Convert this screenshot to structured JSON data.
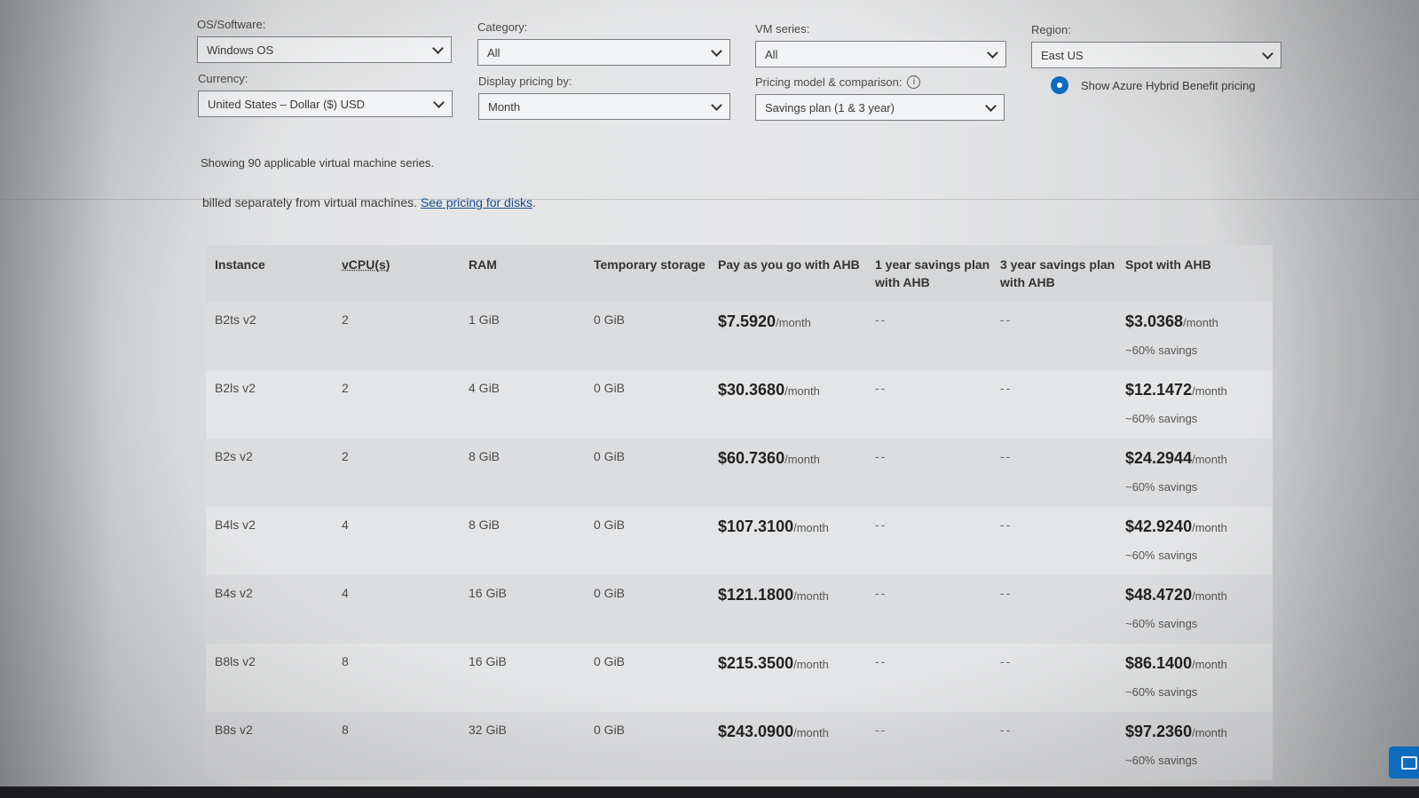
{
  "filters": {
    "os": {
      "label": "OS/Software:",
      "value": "Windows OS"
    },
    "category": {
      "label": "Category:",
      "value": "All"
    },
    "vm_series": {
      "label": "VM series:",
      "value": "All"
    },
    "region": {
      "label": "Region:",
      "value": "East US"
    },
    "currency": {
      "label": "Currency:",
      "value": "United States – Dollar ($) USD"
    },
    "display_pricing": {
      "label": "Display pricing by:",
      "value": "Month"
    },
    "pricing_model": {
      "label": "Pricing model & comparison:",
      "value": "Savings plan (1 & 3 year)",
      "info": "i"
    },
    "ahb_toggle": {
      "label": "Show Azure Hybrid Benefit pricing"
    }
  },
  "showing_text": "Showing 90 applicable virtual machine series.",
  "notice": {
    "text": "billed separately from virtual machines. ",
    "link": "See pricing for disks",
    "end": "."
  },
  "table": {
    "headers": [
      "Instance",
      "vCPU(s)",
      "RAM",
      "Temporary storage",
      "Pay as you go with AHB",
      "1 year savings plan with AHB",
      "3 year savings plan with AHB",
      "Spot with AHB"
    ],
    "per_month": "/month",
    "rows": [
      {
        "instance": "B2ts v2",
        "vcpu": "2",
        "ram": "1 GiB",
        "temp": "0 GiB",
        "payg": "$7.5920",
        "y1": "--",
        "y3": "--",
        "spot": "$3.0368",
        "savings": "~60% savings"
      },
      {
        "instance": "B2ls v2",
        "vcpu": "2",
        "ram": "4 GiB",
        "temp": "0 GiB",
        "payg": "$30.3680",
        "y1": "--",
        "y3": "--",
        "spot": "$12.1472",
        "savings": "~60% savings"
      },
      {
        "instance": "B2s v2",
        "vcpu": "2",
        "ram": "8 GiB",
        "temp": "0 GiB",
        "payg": "$60.7360",
        "y1": "--",
        "y3": "--",
        "spot": "$24.2944",
        "savings": "~60% savings"
      },
      {
        "instance": "B4ls v2",
        "vcpu": "4",
        "ram": "8 GiB",
        "temp": "0 GiB",
        "payg": "$107.3100",
        "y1": "--",
        "y3": "--",
        "spot": "$42.9240",
        "savings": "~60% savings"
      },
      {
        "instance": "B4s v2",
        "vcpu": "4",
        "ram": "16 GiB",
        "temp": "0 GiB",
        "payg": "$121.1800",
        "y1": "--",
        "y3": "--",
        "spot": "$48.4720",
        "savings": "~60% savings"
      },
      {
        "instance": "B8ls v2",
        "vcpu": "8",
        "ram": "16 GiB",
        "temp": "0 GiB",
        "payg": "$215.3500",
        "y1": "--",
        "y3": "--",
        "spot": "$86.1400",
        "savings": "~60% savings"
      },
      {
        "instance": "B8s v2",
        "vcpu": "8",
        "ram": "32 GiB",
        "temp": "0 GiB",
        "payg": "$243.0900",
        "y1": "--",
        "y3": "--",
        "spot": "$97.2360",
        "savings": "~60% savings"
      }
    ]
  },
  "colors": {
    "accent": "#0f6cbd"
  }
}
